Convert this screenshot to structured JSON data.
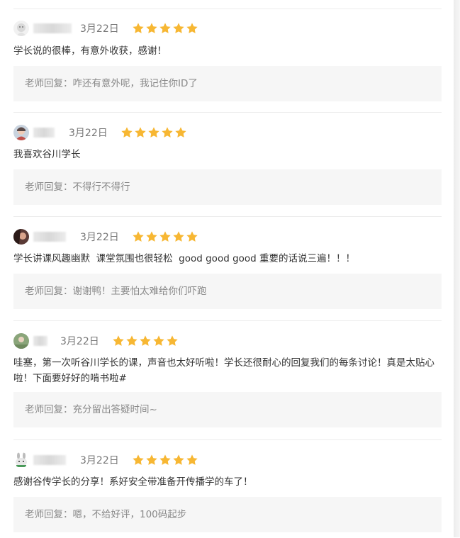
{
  "reviews": [
    {
      "avatar_icon": "gray-sticker-avatar-icon",
      "date": "3月22日",
      "rating": 5,
      "comment": "学长说的很棒，有意外收获，感谢！",
      "reply": "老师回复：咋还有意外呢，我记住你ID了"
    },
    {
      "avatar_icon": "photo-avatar-icon",
      "date": "3月22日",
      "rating": 5,
      "comment": "我喜欢谷川学长",
      "reply": "老师回复：不得行不得行"
    },
    {
      "avatar_icon": "dark-photo-avatar-icon",
      "date": "3月22日",
      "rating": 5,
      "comment": "学长讲课风趣幽默  课堂氛围也很轻松  good good good 重要的话说三遍！！！",
      "reply": "老师回复：谢谢鸭！主要怕太难给你们吓跑"
    },
    {
      "avatar_icon": "green-photo-avatar-icon",
      "date": "3月22日",
      "rating": 5,
      "comment": "哇塞，第一次听谷川学长的课，声音也太好听啦！学长还很耐心的回复我们的每条讨论！真是太贴心啦！下面要好好的啃书啦#",
      "reply": "老师回复：充分留出答疑时间~"
    },
    {
      "avatar_icon": "rabbit-avatar-icon",
      "date": "3月22日",
      "rating": 5,
      "comment": "感谢谷传学长的分享！系好安全带准备开传播学的车了！",
      "reply": "老师回复：嗯，不给好评，100码起步"
    }
  ],
  "colors": {
    "star": "#f7b733",
    "reply_bg": "#f6f6f6",
    "divider": "#ececec"
  }
}
